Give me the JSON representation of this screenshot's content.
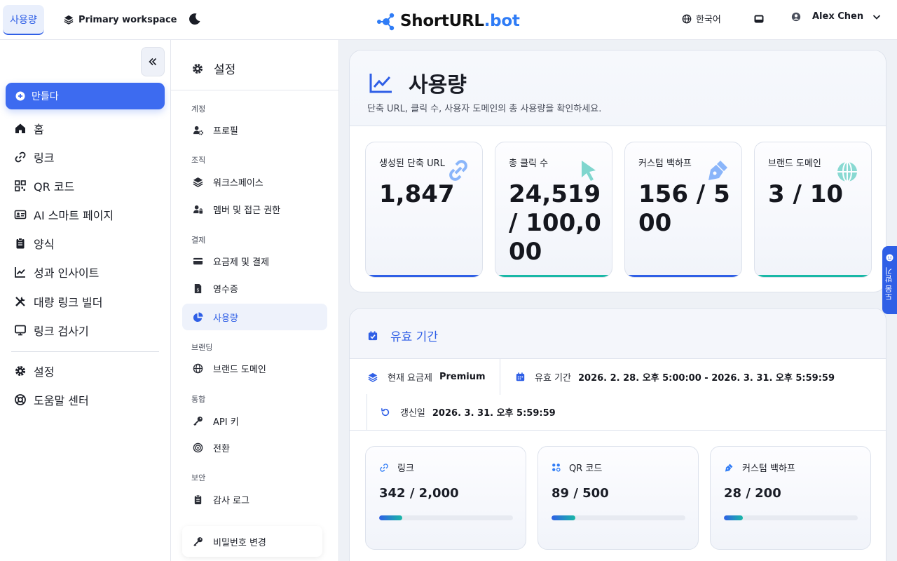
{
  "topbar": {
    "current_tab": "사용량",
    "workspace": "Primary workspace",
    "logo_main": "ShortURL",
    "logo_suffix": ".bot",
    "language": "한국어",
    "user_name": "Alex Chen"
  },
  "sidebar": {
    "create_label": "만들다",
    "items": [
      {
        "label": "홈",
        "icon": "home-icon"
      },
      {
        "label": "링크",
        "icon": "link-icon"
      },
      {
        "label": "QR 코드",
        "icon": "qr-icon"
      },
      {
        "label": "AI 스마트 페이지",
        "icon": "id-card-icon"
      },
      {
        "label": "양식",
        "icon": "clipboard-icon"
      },
      {
        "label": "성과 인사이트",
        "icon": "chart-line-icon"
      },
      {
        "label": "대량 링크 빌더",
        "icon": "tools-icon"
      },
      {
        "label": "링크 검사기",
        "icon": "monitor-icon"
      },
      {
        "label": "설정",
        "icon": "gear-icon"
      },
      {
        "label": "도움말 센터",
        "icon": "lifebuoy-icon"
      }
    ]
  },
  "settings_nav": {
    "title": "설정",
    "sections": {
      "account": "계정",
      "org": "조직",
      "billing": "결제",
      "branding": "브랜딩",
      "integration": "통합",
      "security": "보안"
    },
    "items": {
      "profile": "프로필",
      "workspace": "워크스페이스",
      "members": "멤버 및 접근 권한",
      "plans": "요금제 및 결제",
      "receipts": "영수증",
      "usage": "사용량",
      "brand_domain": "브랜드 도메인",
      "api_key": "API 키",
      "conversion": "전환",
      "audit_log": "감사 로그"
    },
    "change_password": "비밀번호 변경"
  },
  "usage": {
    "title": "사용량",
    "subtitle": "단축 URL, 클릭 수, 사용자 도메인의 총 사용량을 확인하세요.",
    "stats": [
      {
        "label": "생성된 단축 URL",
        "value": "1,847",
        "icon": "link-icon",
        "accent": "#2f5fe6"
      },
      {
        "label": "총 클릭 수",
        "value": "24,519 / 100,000",
        "icon": "cursor-icon",
        "accent": "#19b8a6"
      },
      {
        "label": "커스텀 백하프",
        "value": "156 / 500",
        "icon": "pen-nib-icon",
        "accent": "#2f5fe6"
      },
      {
        "label": "브랜드 도메인",
        "value": "3 / 10",
        "icon": "globe-icon",
        "accent": "#19b8a6"
      }
    ]
  },
  "period": {
    "title": "유효 기간",
    "plan_label": "현재 요금제",
    "plan_value": "Premium",
    "valid_label": "유효 기간",
    "valid_value": "2026. 2. 28. 오후 5:00:00 - 2026. 3. 31. 오후 5:59:59",
    "renew_label": "갱신일",
    "renew_value": "2026. 3. 31. 오후 5:59:59",
    "limits": [
      {
        "label": "링크",
        "value": "342 / 2,000",
        "progress": 0.171,
        "icon": "link-icon"
      },
      {
        "label": "QR 코드",
        "value": "89 / 500",
        "progress": 0.178,
        "icon": "qr-icon"
      },
      {
        "label": "커스텀 백하프",
        "value": "28 / 200",
        "progress": 0.14,
        "icon": "pen-nib-icon"
      }
    ]
  },
  "feedback_label": "도움 받기"
}
